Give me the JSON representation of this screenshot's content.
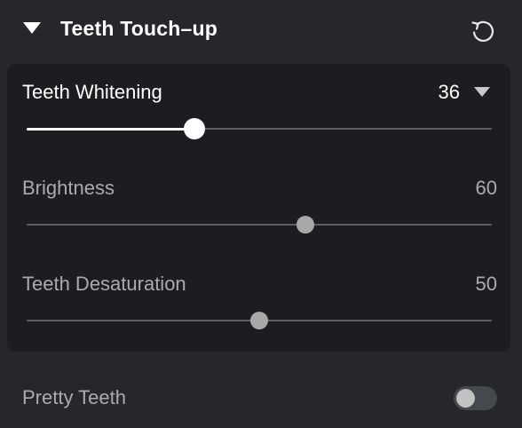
{
  "header": {
    "title": "Teeth Touch–up",
    "collapse_icon": "caret-down-icon",
    "reset_icon": "reset-icon"
  },
  "sliders": [
    {
      "label": "Teeth Whitening",
      "value": "36",
      "fraction": 0.36,
      "active": true,
      "has_dropdown": true
    },
    {
      "label": "Brightness",
      "value": "60",
      "fraction": 0.6,
      "active": false
    },
    {
      "label": "Teeth Desaturation",
      "value": "50",
      "fraction": 0.5,
      "active": false
    }
  ],
  "pretty_teeth": {
    "label": "Pretty Teeth",
    "enabled": false
  },
  "colors": {
    "background": "#25272b",
    "panel": "#1b1d20",
    "active_text": "#ffffff",
    "inactive_text": "#a9abae",
    "track": "#5c5f64",
    "active_knob": "#ffffff",
    "inactive_knob": "#a8a8a8"
  }
}
